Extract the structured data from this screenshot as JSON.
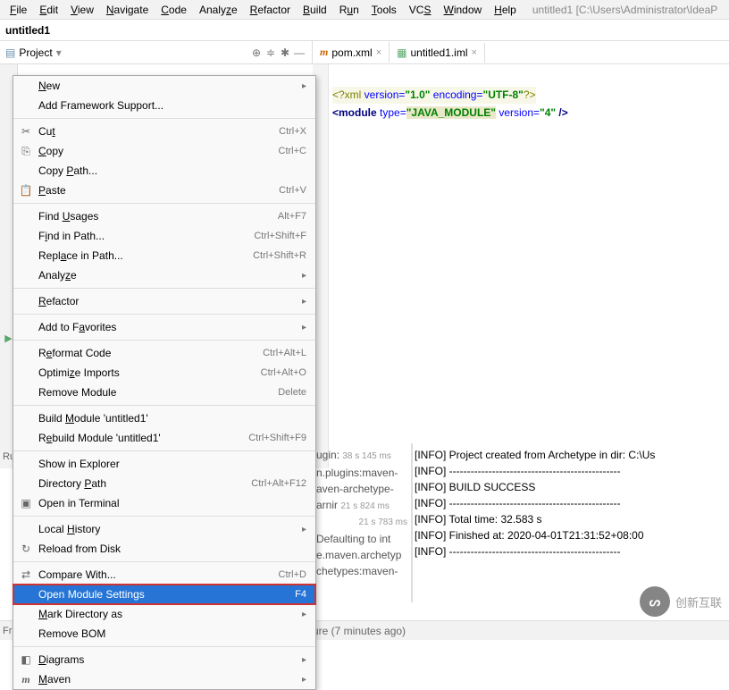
{
  "menubar": {
    "items": [
      "File",
      "Edit",
      "View",
      "Navigate",
      "Code",
      "Analyze",
      "Refactor",
      "Build",
      "Run",
      "Tools",
      "VCS",
      "Window",
      "Help"
    ],
    "title_path": "untitled1 [C:\\Users\\Administrator\\IdeaP"
  },
  "breadcrumb": "untitled1",
  "project_panel": {
    "label": "Project"
  },
  "tabs": [
    {
      "label": "pom.xml",
      "icon": "m-icon"
    },
    {
      "label": "untitled1.iml",
      "icon": "iml-icon"
    }
  ],
  "code": {
    "line1_xml": "<?xml",
    "line1_version_attr": " version=",
    "line1_version_val": "\"1.0\"",
    "line1_encoding_attr": " encoding=",
    "line1_encoding_val": "\"UTF-8\"",
    "line1_end": "?>",
    "line2_open": "<module",
    "line2_type_attr": " type=",
    "line2_type_val": "\"JAVA_MODULE\"",
    "line2_ver_attr": " version=",
    "line2_ver_val": "\"4\"",
    "line2_close": " />"
  },
  "context_menu": [
    {
      "label": "<u>N</u>ew",
      "sub": "▸"
    },
    {
      "label": "Add Framework Support..."
    },
    {
      "sep": true
    },
    {
      "icon": "✂",
      "label": "Cu<u>t</u>",
      "shortcut": "Ctrl+X"
    },
    {
      "icon": "⎘",
      "label": "<u>C</u>opy",
      "shortcut": "Ctrl+C"
    },
    {
      "label": "Copy <u>P</u>ath..."
    },
    {
      "icon": "📋",
      "label": "<u>P</u>aste",
      "shortcut": "Ctrl+V"
    },
    {
      "sep": true
    },
    {
      "label": "Find <u>U</u>sages",
      "shortcut": "Alt+F7"
    },
    {
      "label": "F<u>i</u>nd in Path...",
      "shortcut": "Ctrl+Shift+F"
    },
    {
      "label": "Repl<u>a</u>ce in Path...",
      "shortcut": "Ctrl+Shift+R"
    },
    {
      "label": "Analy<u>z</u>e",
      "sub": "▸"
    },
    {
      "sep": true
    },
    {
      "label": "<u>R</u>efactor",
      "sub": "▸"
    },
    {
      "sep": true
    },
    {
      "label": "Add to F<u>a</u>vorites",
      "sub": "▸"
    },
    {
      "sep": true
    },
    {
      "label": "R<u>e</u>format Code",
      "shortcut": "Ctrl+Alt+L"
    },
    {
      "label": "Optimi<u>z</u>e Imports",
      "shortcut": "Ctrl+Alt+O"
    },
    {
      "label": "Remove Module",
      "shortcut": "Delete"
    },
    {
      "sep": true
    },
    {
      "label": "Build <u>M</u>odule 'untitled1'"
    },
    {
      "label": "R<u>e</u>build Module 'untitled1'",
      "shortcut": "Ctrl+Shift+F9"
    },
    {
      "sep": true
    },
    {
      "label": "Show in Explorer"
    },
    {
      "label": "Directory <u>P</u>ath",
      "shortcut": "Ctrl+Alt+F12"
    },
    {
      "icon": "▣",
      "label": "Open in Terminal"
    },
    {
      "sep": true
    },
    {
      "label": "Local <u>H</u>istory",
      "sub": "▸"
    },
    {
      "icon": "↻",
      "label": "Reload from Disk"
    },
    {
      "sep": true
    },
    {
      "icon": "⇄",
      "label": "Compare With...",
      "shortcut": "Ctrl+D"
    },
    {
      "label": "Open Module Settings",
      "shortcut": "F4",
      "selected": true,
      "highlighted": true
    },
    {
      "label": "<u>M</u>ark Directory as",
      "sub": "▸"
    },
    {
      "label": "Remove BOM"
    },
    {
      "sep": true
    },
    {
      "icon": "◧",
      "label": "<u>D</u>iagrams",
      "sub": "▸"
    },
    {
      "icon": "m",
      "miclass": "m-icon",
      "label": "<u>M</u>aven",
      "sub": "▸"
    }
  ],
  "console_left": {
    "plugin": "ugin:",
    "plugin_t": "38 s 145 ms",
    "line2": "n.plugins:maven-",
    "line3": "aven-archetype-",
    "line4": "arnir",
    "line4_t": "21 s 824 ms",
    "line5_t": "21 s 783 ms",
    "line6": "Defaulting to int",
    "line7": "e.maven.archetyp",
    "line8": "chetypes:maven-"
  },
  "console_right": [
    "[INFO] Project created from Archetype in dir: C:\\Us",
    "[INFO] ------------------------------------------------",
    "[INFO] BUILD SUCCESS",
    "[INFO] ------------------------------------------------",
    "[INFO] Total time:  32.583 s",
    "[INFO] Finished at: 2020-04-01T21:31:52+08:00",
    "[INFO] ------------------------------------------------"
  ],
  "left_rail": {
    "run": "Ru",
    "fr": "Fr"
  },
  "status": "ure (7 minutes ago)",
  "watermark": "创新互联"
}
